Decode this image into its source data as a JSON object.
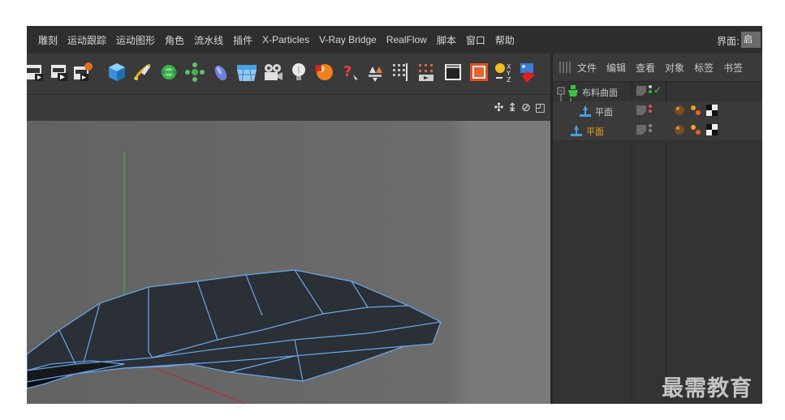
{
  "menubar": {
    "items": [
      "雕刻",
      "运动跟踪",
      "运动图形",
      "角色",
      "流水线",
      "插件",
      "X-Particles",
      "V-Ray Bridge",
      "RealFlow",
      "脚本",
      "窗口",
      "帮助"
    ],
    "layout_label": "界面:",
    "layout_value": "启动"
  },
  "toolbar": {
    "icons": [
      "render-region-icon",
      "render-view-icon",
      "render-settings-icon",
      "cube-icon",
      "pen-spline-icon",
      "subdivision-icon",
      "array-icon",
      "deformer-icon",
      "floor-icon",
      "camera-icon",
      "light-icon",
      "material-icon",
      "help-icon",
      "symmetry-icon",
      "tracer-icon",
      "grid-icon",
      "film-icon",
      "frame-icon",
      "xyz-icon",
      "cloth-tag-icon"
    ]
  },
  "viewport": {
    "nav_icons": [
      "move-view-icon",
      "zoom-view-icon",
      "rotate-view-icon",
      "maximize-view-icon"
    ]
  },
  "object_manager": {
    "menu": [
      "文件",
      "编辑",
      "查看",
      "对象",
      "标签",
      "书签"
    ],
    "objects": [
      {
        "name": "布料曲面",
        "color": "#c8c8c8",
        "visibility": "green-check"
      },
      {
        "name": "平面",
        "color": "#c8c8c8",
        "visibility": "red"
      },
      {
        "name": "平面",
        "color": "#f0a020",
        "visibility": "gray"
      }
    ]
  },
  "watermark": "最需教育",
  "colors": {
    "viewport_bg": "#6b6b6b",
    "mesh_face": "#2b2f36",
    "mesh_edge": "#6aa8e8",
    "axis_y": "#3cb043",
    "axis_x": "#b03030",
    "axis_z": "#3030c0"
  }
}
